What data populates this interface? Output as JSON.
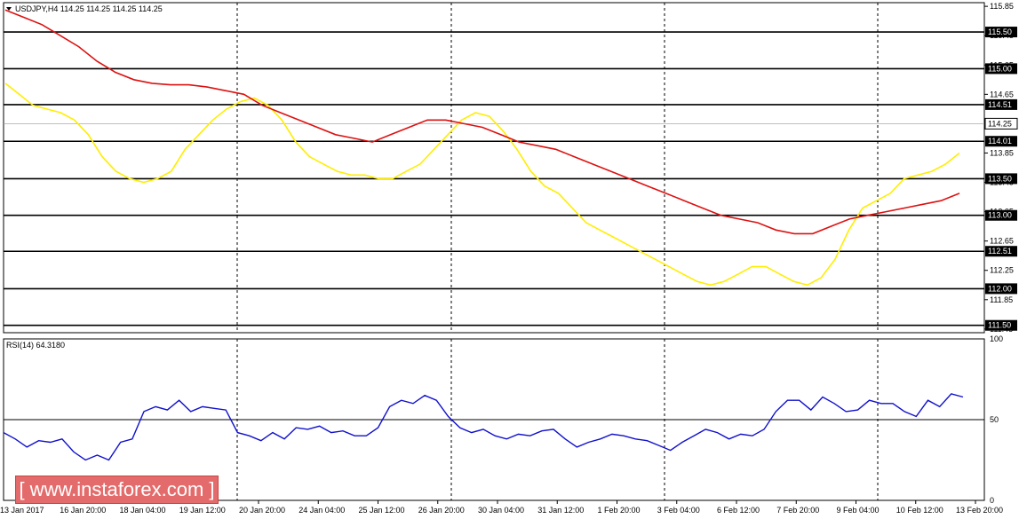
{
  "chart_data": [
    {
      "type": "candlestick",
      "title": "USDJPY,H4  114.25 114.25 114.25 114.25",
      "symbol": "USDJPY",
      "timeframe": "H4",
      "ohlc_header": "114.25 114.25 114.25 114.25",
      "y_ticks": [
        "115.85",
        "115.45",
        "115.05",
        "114.65",
        "114.25",
        "113.85",
        "113.45",
        "113.05",
        "112.65",
        "112.25",
        "111.85",
        "111.45"
      ],
      "ylim": [
        111.4,
        115.9
      ],
      "x_tick_labels": [
        "13 Jan 2017",
        "16 Jan 20:00",
        "18 Jan 04:00",
        "19 Jan 12:00",
        "20 Jan 20:00",
        "24 Jan 04:00",
        "25 Jan 12:00",
        "26 Jan 20:00",
        "30 Jan 04:00",
        "31 Jan 12:00",
        "1 Feb 20:00",
        "3 Feb 04:00",
        "6 Feb 12:00",
        "7 Feb 20:00",
        "9 Feb 04:00",
        "10 Feb 12:00",
        "13 Feb 20:00"
      ],
      "horizontal_levels": [
        "115.50",
        "115.00",
        "114.51",
        "114.01",
        "113.50",
        "113.00",
        "112.51",
        "112.00",
        "111.50"
      ],
      "current_price_label": "114.25",
      "series": [
        {
          "name": "",
          "color": "#ffee00",
          "kind": "moving-average-fast",
          "values": [
            114.8,
            114.65,
            114.5,
            114.45,
            114.4,
            114.3,
            114.1,
            113.8,
            113.6,
            113.5,
            113.45,
            113.5,
            113.6,
            113.9,
            114.1,
            114.3,
            114.45,
            114.55,
            114.6,
            114.5,
            114.3,
            114.0,
            113.8,
            113.7,
            113.6,
            113.55,
            113.55,
            113.5,
            113.5,
            113.6,
            113.7,
            113.9,
            114.1,
            114.3,
            114.4,
            114.35,
            114.15,
            113.9,
            113.6,
            113.4,
            113.3,
            113.1,
            112.9,
            112.8,
            112.7,
            112.6,
            112.5,
            112.4,
            112.3,
            112.2,
            112.1,
            112.05,
            112.1,
            112.2,
            112.3,
            112.3,
            112.2,
            112.1,
            112.05,
            112.15,
            112.4,
            112.8,
            113.1,
            113.2,
            113.3,
            113.5,
            113.55,
            113.6,
            113.7,
            113.85
          ]
        },
        {
          "name": "",
          "color": "#dd1111",
          "kind": "moving-average-slow",
          "values": [
            115.8,
            115.7,
            115.6,
            115.45,
            115.3,
            115.1,
            114.95,
            114.85,
            114.8,
            114.78,
            114.78,
            114.75,
            114.7,
            114.65,
            114.5,
            114.4,
            114.3,
            114.2,
            114.1,
            114.05,
            114.0,
            114.1,
            114.2,
            114.3,
            114.3,
            114.25,
            114.2,
            114.1,
            114.0,
            113.95,
            113.9,
            113.8,
            113.7,
            113.6,
            113.5,
            113.4,
            113.3,
            113.2,
            113.1,
            113.0,
            112.95,
            112.9,
            112.8,
            112.75,
            112.75,
            112.85,
            112.95,
            113.0,
            113.05,
            113.1,
            113.15,
            113.2,
            113.3
          ]
        }
      ]
    },
    {
      "type": "line",
      "title": "RSI(14) 64.3180",
      "y_ticks": [
        "100",
        "50",
        "0"
      ],
      "ylim": [
        0,
        100
      ],
      "level": 50,
      "series": [
        {
          "name": "",
          "color": "#1111cc",
          "values": [
            42,
            38,
            33,
            37,
            36,
            38,
            30,
            25,
            28,
            25,
            36,
            38,
            55,
            58,
            56,
            62,
            55,
            58,
            57,
            56,
            42,
            40,
            37,
            42,
            38,
            45,
            44,
            46,
            42,
            43,
            40,
            40,
            45,
            58,
            62,
            60,
            65,
            62,
            52,
            45,
            42,
            44,
            40,
            38,
            41,
            40,
            43,
            44,
            38,
            33,
            36,
            38,
            41,
            40,
            38,
            37,
            34,
            31,
            36,
            40,
            44,
            42,
            38,
            41,
            40,
            44,
            55,
            62,
            62,
            56,
            64,
            60,
            55,
            56,
            62,
            60,
            60,
            55,
            52,
            62,
            58,
            66,
            64
          ]
        }
      ]
    }
  ],
  "watermark": "[  www.instaforex.com  ]",
  "colors": {
    "bull": "#007a2a",
    "bear": "#e11111",
    "ma_fast": "#ffee00",
    "ma_slow": "#dd1111",
    "rsi": "#1111cc",
    "level": "#000000"
  }
}
